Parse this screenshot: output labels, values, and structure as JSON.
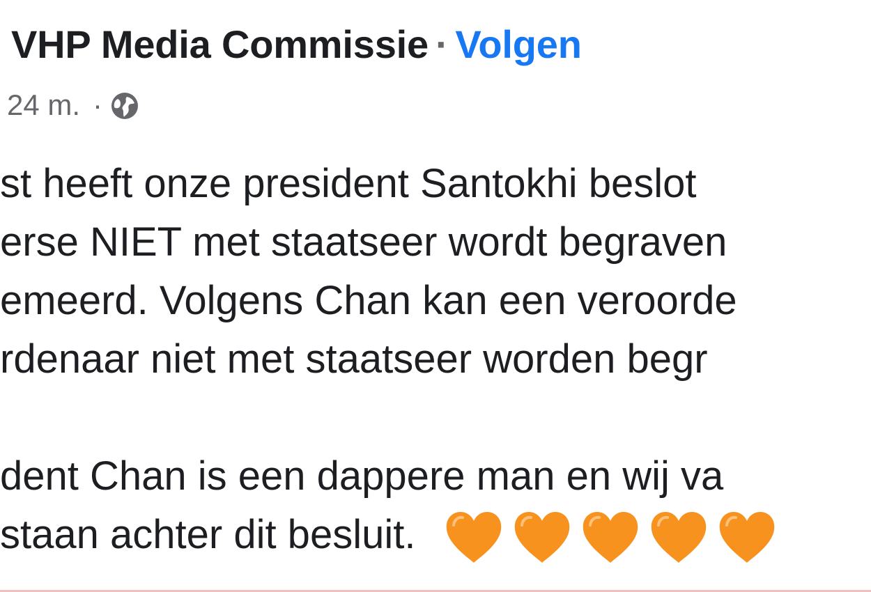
{
  "post": {
    "author": "VHP Media Commissie",
    "separator": "·",
    "follow_label": "Volgen",
    "time": "24 m.",
    "meta_dot": "·",
    "privacy_icon": "globe-icon",
    "lines": [
      "st heeft onze president Santokhi beslot",
      "erse NIET met staatseer wordt begraven",
      "emeerd. Volgens Chan kan een veroorde",
      "rdenaar niet met staatseer worden begr"
    ],
    "para2_lines": [
      "dent Chan is een dappere man en wij va",
      "staan achter dit besluit."
    ],
    "emoji": {
      "name": "orange-heart-icon",
      "count": 5,
      "color": "#f7921e"
    }
  },
  "colors": {
    "text": "#1c1e21",
    "secondary": "#65676b",
    "link": "#1877f2"
  }
}
